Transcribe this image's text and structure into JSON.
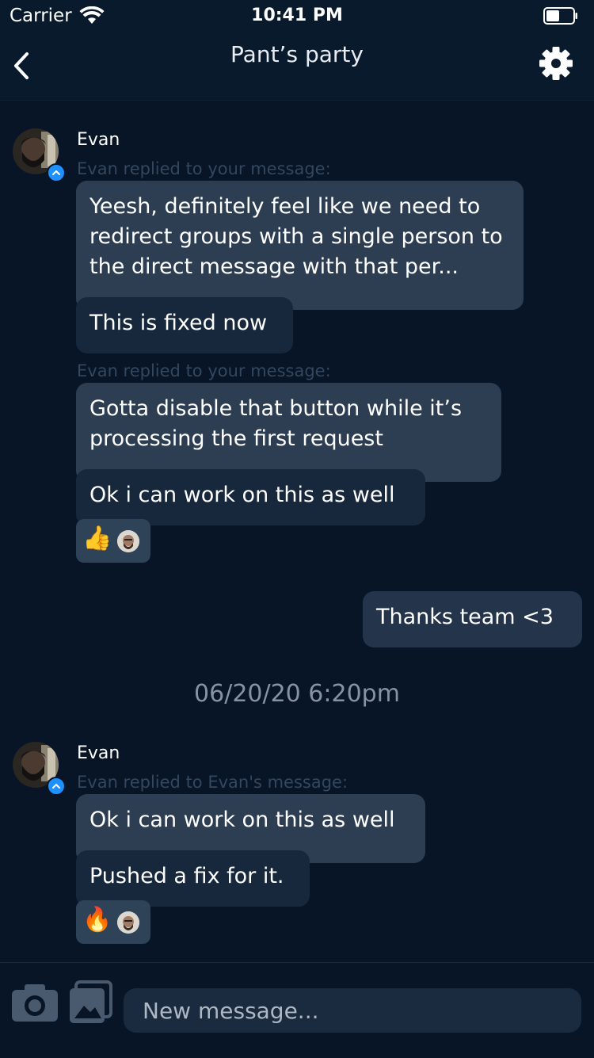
{
  "status_bar": {
    "carrier": "Carrier",
    "time": "10:41 PM"
  },
  "header": {
    "title": "Pant’s party"
  },
  "thread": [
    {
      "sender": "Evan",
      "reply_note_1": "Evan replied to your message:",
      "quote_1": "Yeesh, definitely feel like we need to redirect groups with a single person to the direct message with that per...",
      "message_1": "This is fixed now",
      "reply_note_2": "Evan replied to your message:",
      "quote_2": "Gotta disable that button while it’s processing the first request",
      "message_2": "Ok i can work on this as well",
      "reaction_emoji": "👍"
    },
    {
      "own_message": "Thanks team <3"
    },
    {
      "date_separator": "06/20/20 6:20pm"
    },
    {
      "sender": "Evan",
      "reply_note": "Evan replied to Evan's message:",
      "quote": "Ok i can work on this as well",
      "message": "Pushed a fix for it.",
      "reaction_emoji": "🔥"
    }
  ],
  "composer": {
    "placeholder": "New message..."
  },
  "colors": {
    "background": "#071527",
    "bubble_quote": "#2e3e52",
    "bubble_message": "#17283d",
    "accent": "#1e90ff"
  },
  "icons": [
    "wifi-icon",
    "battery-icon",
    "back-icon",
    "gear-icon",
    "camera-icon",
    "gallery-icon"
  ]
}
